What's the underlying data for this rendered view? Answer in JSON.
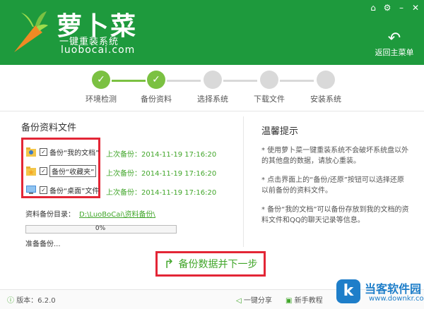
{
  "header": {
    "title": "萝卜菜",
    "subtitle": "一键重装系统",
    "url": "luobocai.com",
    "back_label": "返回主菜单",
    "window_controls": [
      "home-icon",
      "gear-icon",
      "minimize-icon",
      "close-icon"
    ]
  },
  "steps": [
    {
      "label": "环境检测",
      "status": "done"
    },
    {
      "label": "备份资料",
      "status": "done"
    },
    {
      "label": "选择系统",
      "status": "todo"
    },
    {
      "label": "下载文件",
      "status": "todo"
    },
    {
      "label": "安装系统",
      "status": "todo"
    }
  ],
  "backup": {
    "section_title": "备份资料文件",
    "items": [
      {
        "label": "备份“我的文档”",
        "last": "上次备份：2014-11-19 17:16:20"
      },
      {
        "label": "备份“收藏夹”",
        "last": "上次备份：2014-11-19 17:16:20"
      },
      {
        "label": "备份“桌面”文件",
        "last": "上次备份：2014-11-19 17:16:20"
      }
    ],
    "dir_label": "资料备份目录：",
    "dir_path": "D:\\LuoBoCai\\资料备份\\",
    "progress_text": "0%",
    "progress": 0,
    "status": "准备备份..."
  },
  "tips": {
    "title": "温馨提示",
    "items": [
      "* 使用萝卜菜一键重装系统不会破坏系统盘以外的其他盘的数据，请放心重装。",
      "* 点击界面上的“备份/还原”按钮可以选择还原以前备份的资料文件。",
      "* 备份“我的文档”可以备份存放到我的文档的资料文件和QQ的聊天记录等信息。"
    ]
  },
  "next_button": "备份数据并下一步",
  "footer": {
    "version": "版本：6.2.0",
    "share": "一键分享",
    "tutorial": "新手教程"
  },
  "watermark": {
    "name": "当客软件园",
    "url": "www.downkr.com"
  },
  "colors": {
    "brand_green": "#1e9a3d",
    "accent_green": "#41a62a",
    "step_done": "#7bc142",
    "highlight_red": "#e32636"
  }
}
